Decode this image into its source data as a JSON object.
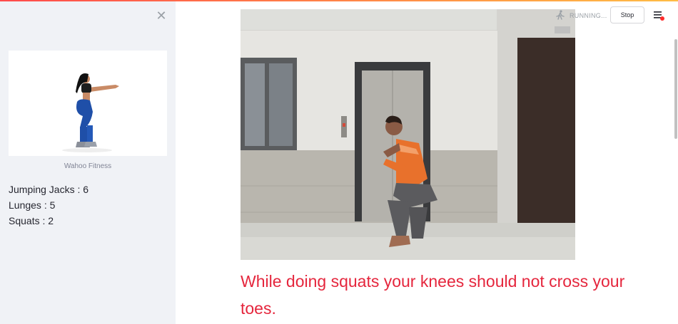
{
  "sidebar": {
    "close_icon": "close-icon",
    "image_caption": "Wahoo Fitness",
    "exercises": [
      {
        "label": "Jumping Jacks : 6"
      },
      {
        "label": "Lunges : 5"
      },
      {
        "label": "Squats : 2"
      }
    ]
  },
  "header": {
    "status_text": "RUNNING...",
    "status_icon": "running-man-icon",
    "stop_label": "Stop",
    "menu_icon": "hamburger-menu-icon"
  },
  "main": {
    "feedback_message": "While doing squats your knees should not cross your toes."
  },
  "colors": {
    "accent": "#ff4b4b",
    "message": "#e5263d",
    "sidebar_bg": "#f0f2f6"
  }
}
